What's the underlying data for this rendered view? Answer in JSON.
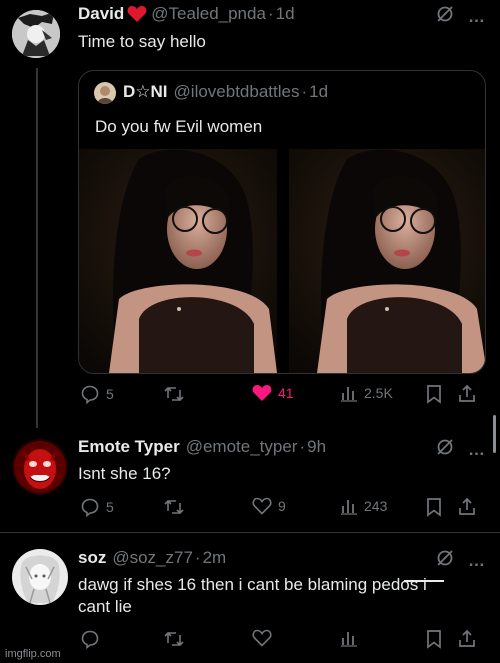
{
  "tweets": [
    {
      "display_name": "David",
      "handle": "@Tealed_pnda",
      "separator": "·",
      "time": "1d",
      "text": "Time to say hello",
      "quote": {
        "display_name": "D☆NI",
        "handle": "@ilovebtdbattles",
        "separator": "·",
        "time": "1d",
        "text": "Do you fw Evil women"
      },
      "actions": {
        "replies": "5",
        "likes": "41",
        "views": "2.5K",
        "liked": true
      }
    },
    {
      "display_name": "Emote Typer",
      "handle": "@emote_typer",
      "separator": "·",
      "time": "9h",
      "text": "Isnt she 16?",
      "actions": {
        "replies": "5",
        "likes": "9",
        "views": "243",
        "liked": false
      }
    },
    {
      "display_name": "soz",
      "handle": "@soz_z77",
      "separator": "·",
      "time": "2m",
      "text_line1": "dawg if shes 16 then i cant be blaming pedos i",
      "text_line2": "cant lie",
      "actions": {
        "replies": "",
        "likes": "",
        "views": "",
        "liked": false
      }
    }
  ],
  "more_icon": "…",
  "watermark": "imgflip.com",
  "colors": {
    "like_active": "#f91880",
    "muted": "#71767b",
    "text": "#e7e9ea",
    "border": "#2f3336"
  },
  "icons": [
    "heart-emoji-icon",
    "grok-slash-icon",
    "more-icon",
    "reply-icon",
    "retweet-icon",
    "like-icon",
    "views-icon",
    "bookmark-icon",
    "share-icon"
  ]
}
